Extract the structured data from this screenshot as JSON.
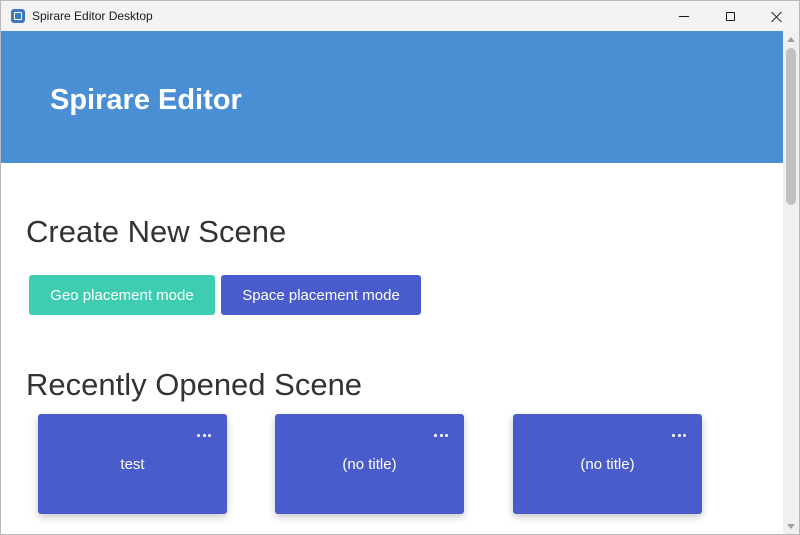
{
  "window": {
    "title": "Spirare Editor Desktop",
    "icon": "app-icon",
    "controls": [
      "minimize-icon",
      "maximize-icon",
      "close-icon"
    ]
  },
  "header": {
    "title": "Spirare Editor",
    "background_color": "#4a8fd4"
  },
  "create_section": {
    "heading": "Create New Scene",
    "geo_button_label": "Geo placement mode",
    "geo_button_color": "#3ecdb0",
    "space_button_label": "Space placement mode",
    "space_button_color": "#4a5ccb"
  },
  "recent_section": {
    "heading": "Recently Opened Scene",
    "cards": [
      {
        "title": "test",
        "menu_icon": "more-icon"
      },
      {
        "title": "(no title)",
        "menu_icon": "more-icon"
      },
      {
        "title": "(no title)",
        "menu_icon": "more-icon"
      }
    ],
    "card_color": "#4a5ccb"
  }
}
